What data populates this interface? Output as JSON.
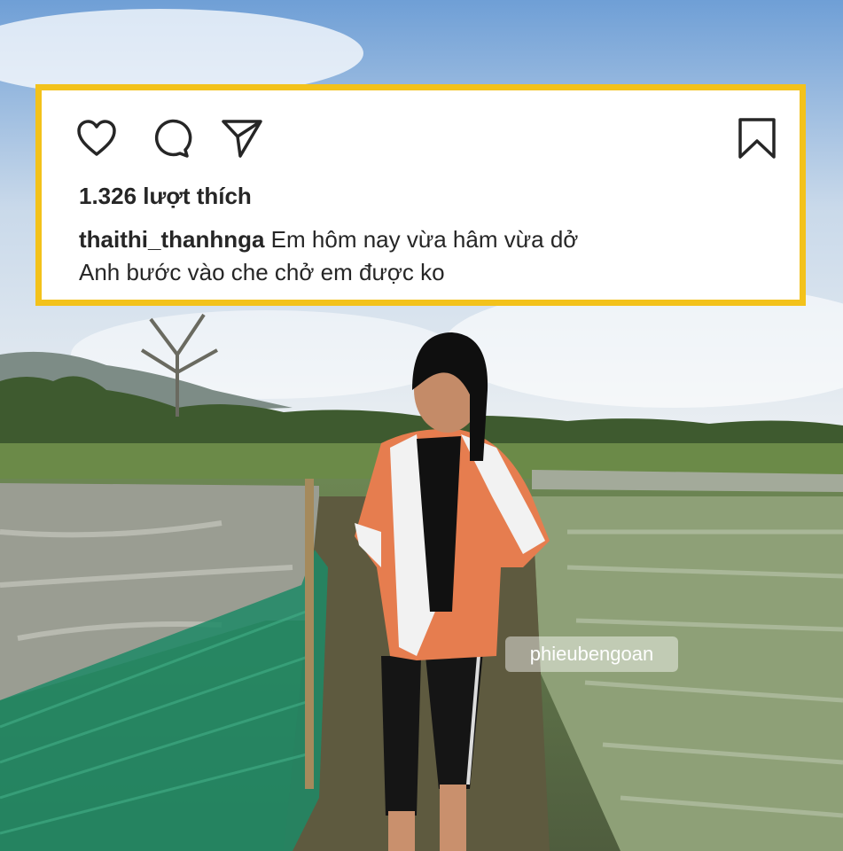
{
  "post": {
    "likes": "1.326 lượt thích",
    "username": "thaithi_thanhnga",
    "caption_line1": "Em hôm nay vừa hâm vừa dở",
    "caption_line2": "Anh bước vào che chở em được ko"
  },
  "watermark": "phieubengoan",
  "icons": [
    "heart-icon",
    "comment-icon",
    "share-icon",
    "bookmark-icon"
  ],
  "colors": {
    "frame": "#f3c21b",
    "text": "#262626",
    "card": "#ffffff"
  }
}
